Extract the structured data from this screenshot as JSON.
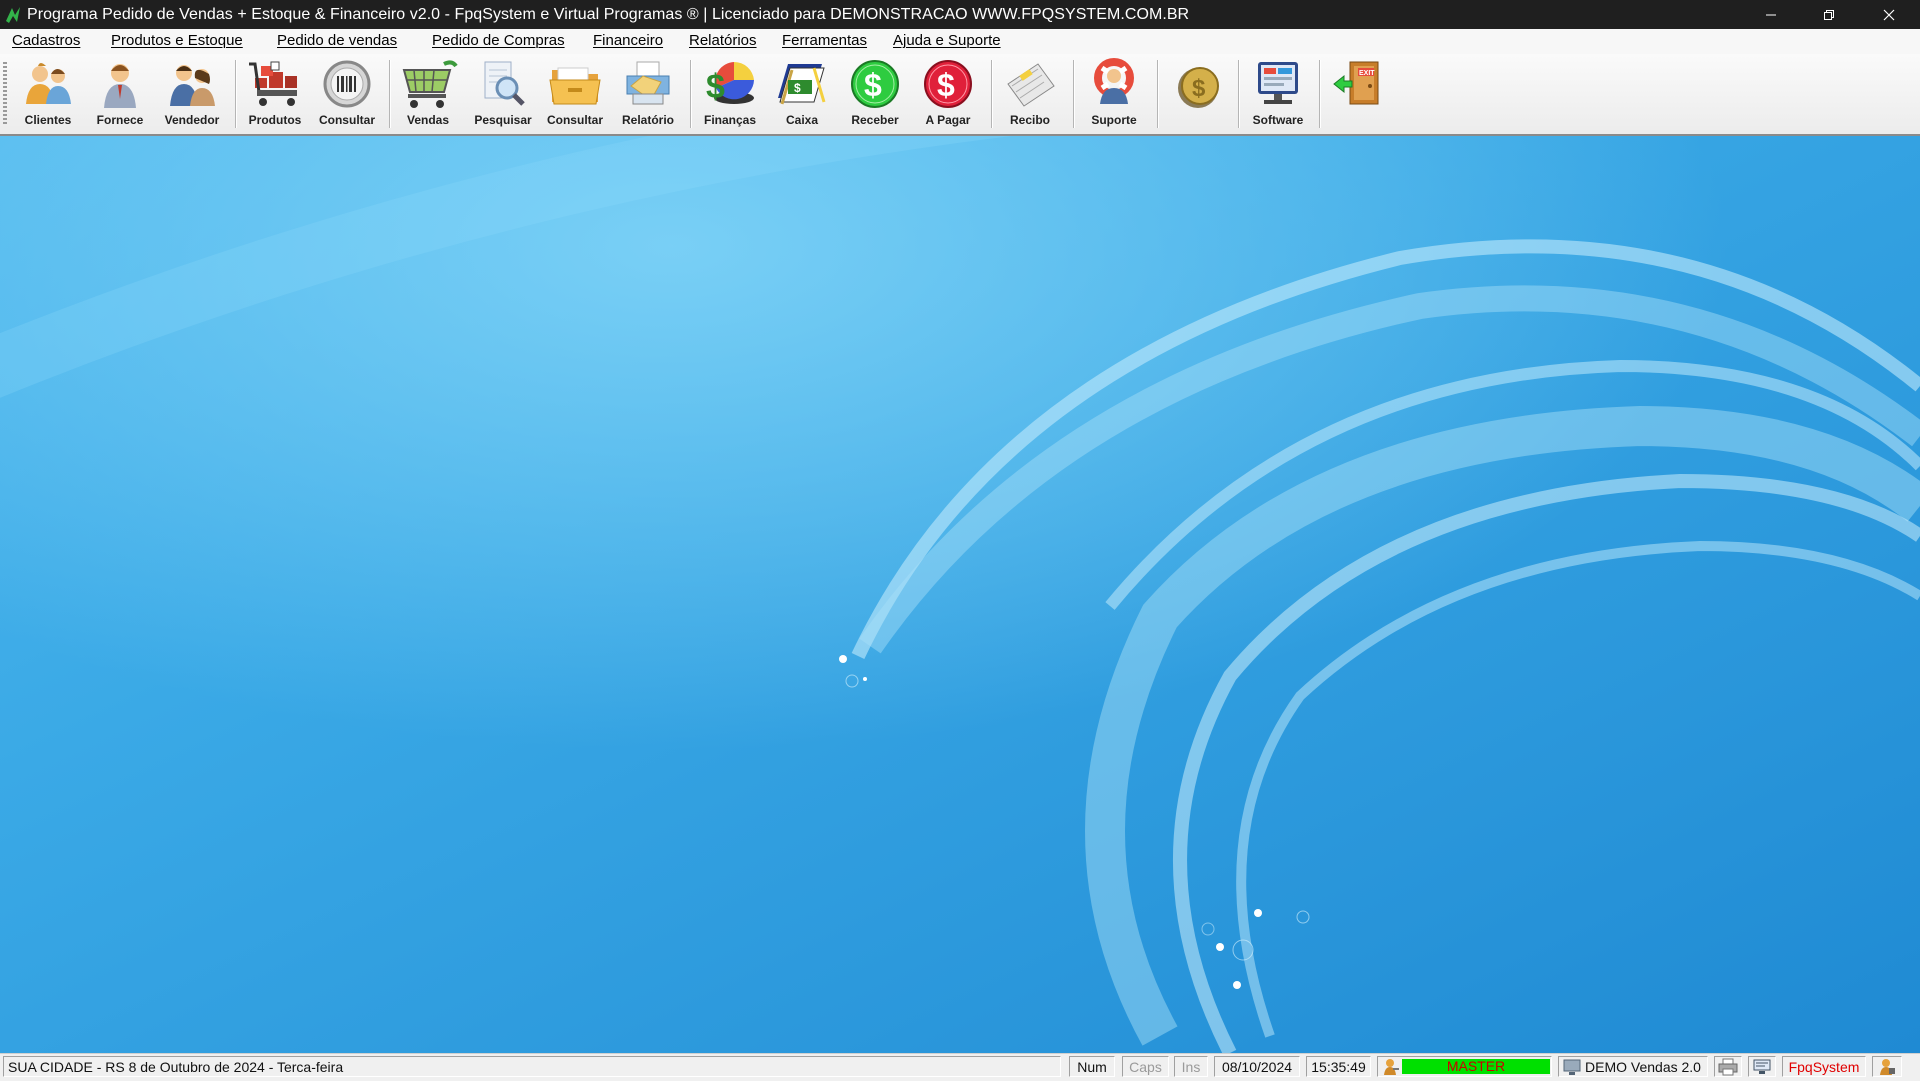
{
  "window": {
    "title": "Programa Pedido de Vendas + Estoque & Financeiro v2.0 - FpqSystem e Virtual Programas ® | Licenciado para  DEMONSTRACAO WWW.FPQSYSTEM.COM.BR",
    "icon": "green-dollar-logo-icon",
    "controls": [
      "minimize-icon",
      "restore-icon",
      "close-icon"
    ]
  },
  "menu": {
    "items": [
      {
        "label": "Cadastros"
      },
      {
        "label": "Produtos e Estoque"
      },
      {
        "label": "Pedido de vendas"
      },
      {
        "label": "Pedido de Compras"
      },
      {
        "label": "Financeiro"
      },
      {
        "label": "Relatórios"
      },
      {
        "label": "Ferramentas"
      },
      {
        "label": "Ajuda e Suporte"
      }
    ]
  },
  "toolbar": {
    "buttons": [
      {
        "label": "Clientes",
        "icon": "clients-people-icon"
      },
      {
        "label": "Fornece",
        "icon": "supplier-man-icon"
      },
      {
        "label": "Vendedor",
        "icon": "salesperson-icon"
      },
      {
        "label": "Produtos",
        "icon": "products-cart-icon"
      },
      {
        "label": "Consultar",
        "icon": "barcode-search-icon"
      },
      {
        "label": "Vendas",
        "icon": "sales-cart-icon"
      },
      {
        "label": "Pesquisar",
        "icon": "document-search-icon"
      },
      {
        "label": "Consultar",
        "icon": "folder-icon"
      },
      {
        "label": "Relatório",
        "icon": "printer-report-icon"
      },
      {
        "label": "Finanças",
        "icon": "finance-pie-icon"
      },
      {
        "label": "Caixa",
        "icon": "cash-book-icon"
      },
      {
        "label": "Receber",
        "icon": "receive-dollar-icon"
      },
      {
        "label": "A Pagar",
        "icon": "pay-dollar-icon"
      },
      {
        "label": "Recibo",
        "icon": "receipt-icon"
      },
      {
        "label": "Suporte",
        "icon": "support-lifebuoy-icon"
      },
      {
        "label": "",
        "icon": "coin-icon"
      },
      {
        "label": "Software",
        "icon": "software-monitor-icon"
      },
      {
        "label": "",
        "icon": "exit-door-icon"
      }
    ]
  },
  "statusbar": {
    "location_date": "SUA CIDADE - RS  8 de Outubro de 2024 - Terca-feira",
    "num": "Num",
    "caps": "Caps",
    "ins": "Ins",
    "date": "08/10/2024",
    "time": "15:35:49",
    "user": "MASTER",
    "user_color": "#00e000",
    "user_text_color": "#cc0000",
    "version": "DEMO Vendas 2.0",
    "brand": "FpqSystem",
    "brand_color": "#e00000",
    "icons": [
      "user-key-icon",
      "computer-icon",
      "printer-icon",
      "network-icon",
      "user-lock-icon"
    ]
  }
}
